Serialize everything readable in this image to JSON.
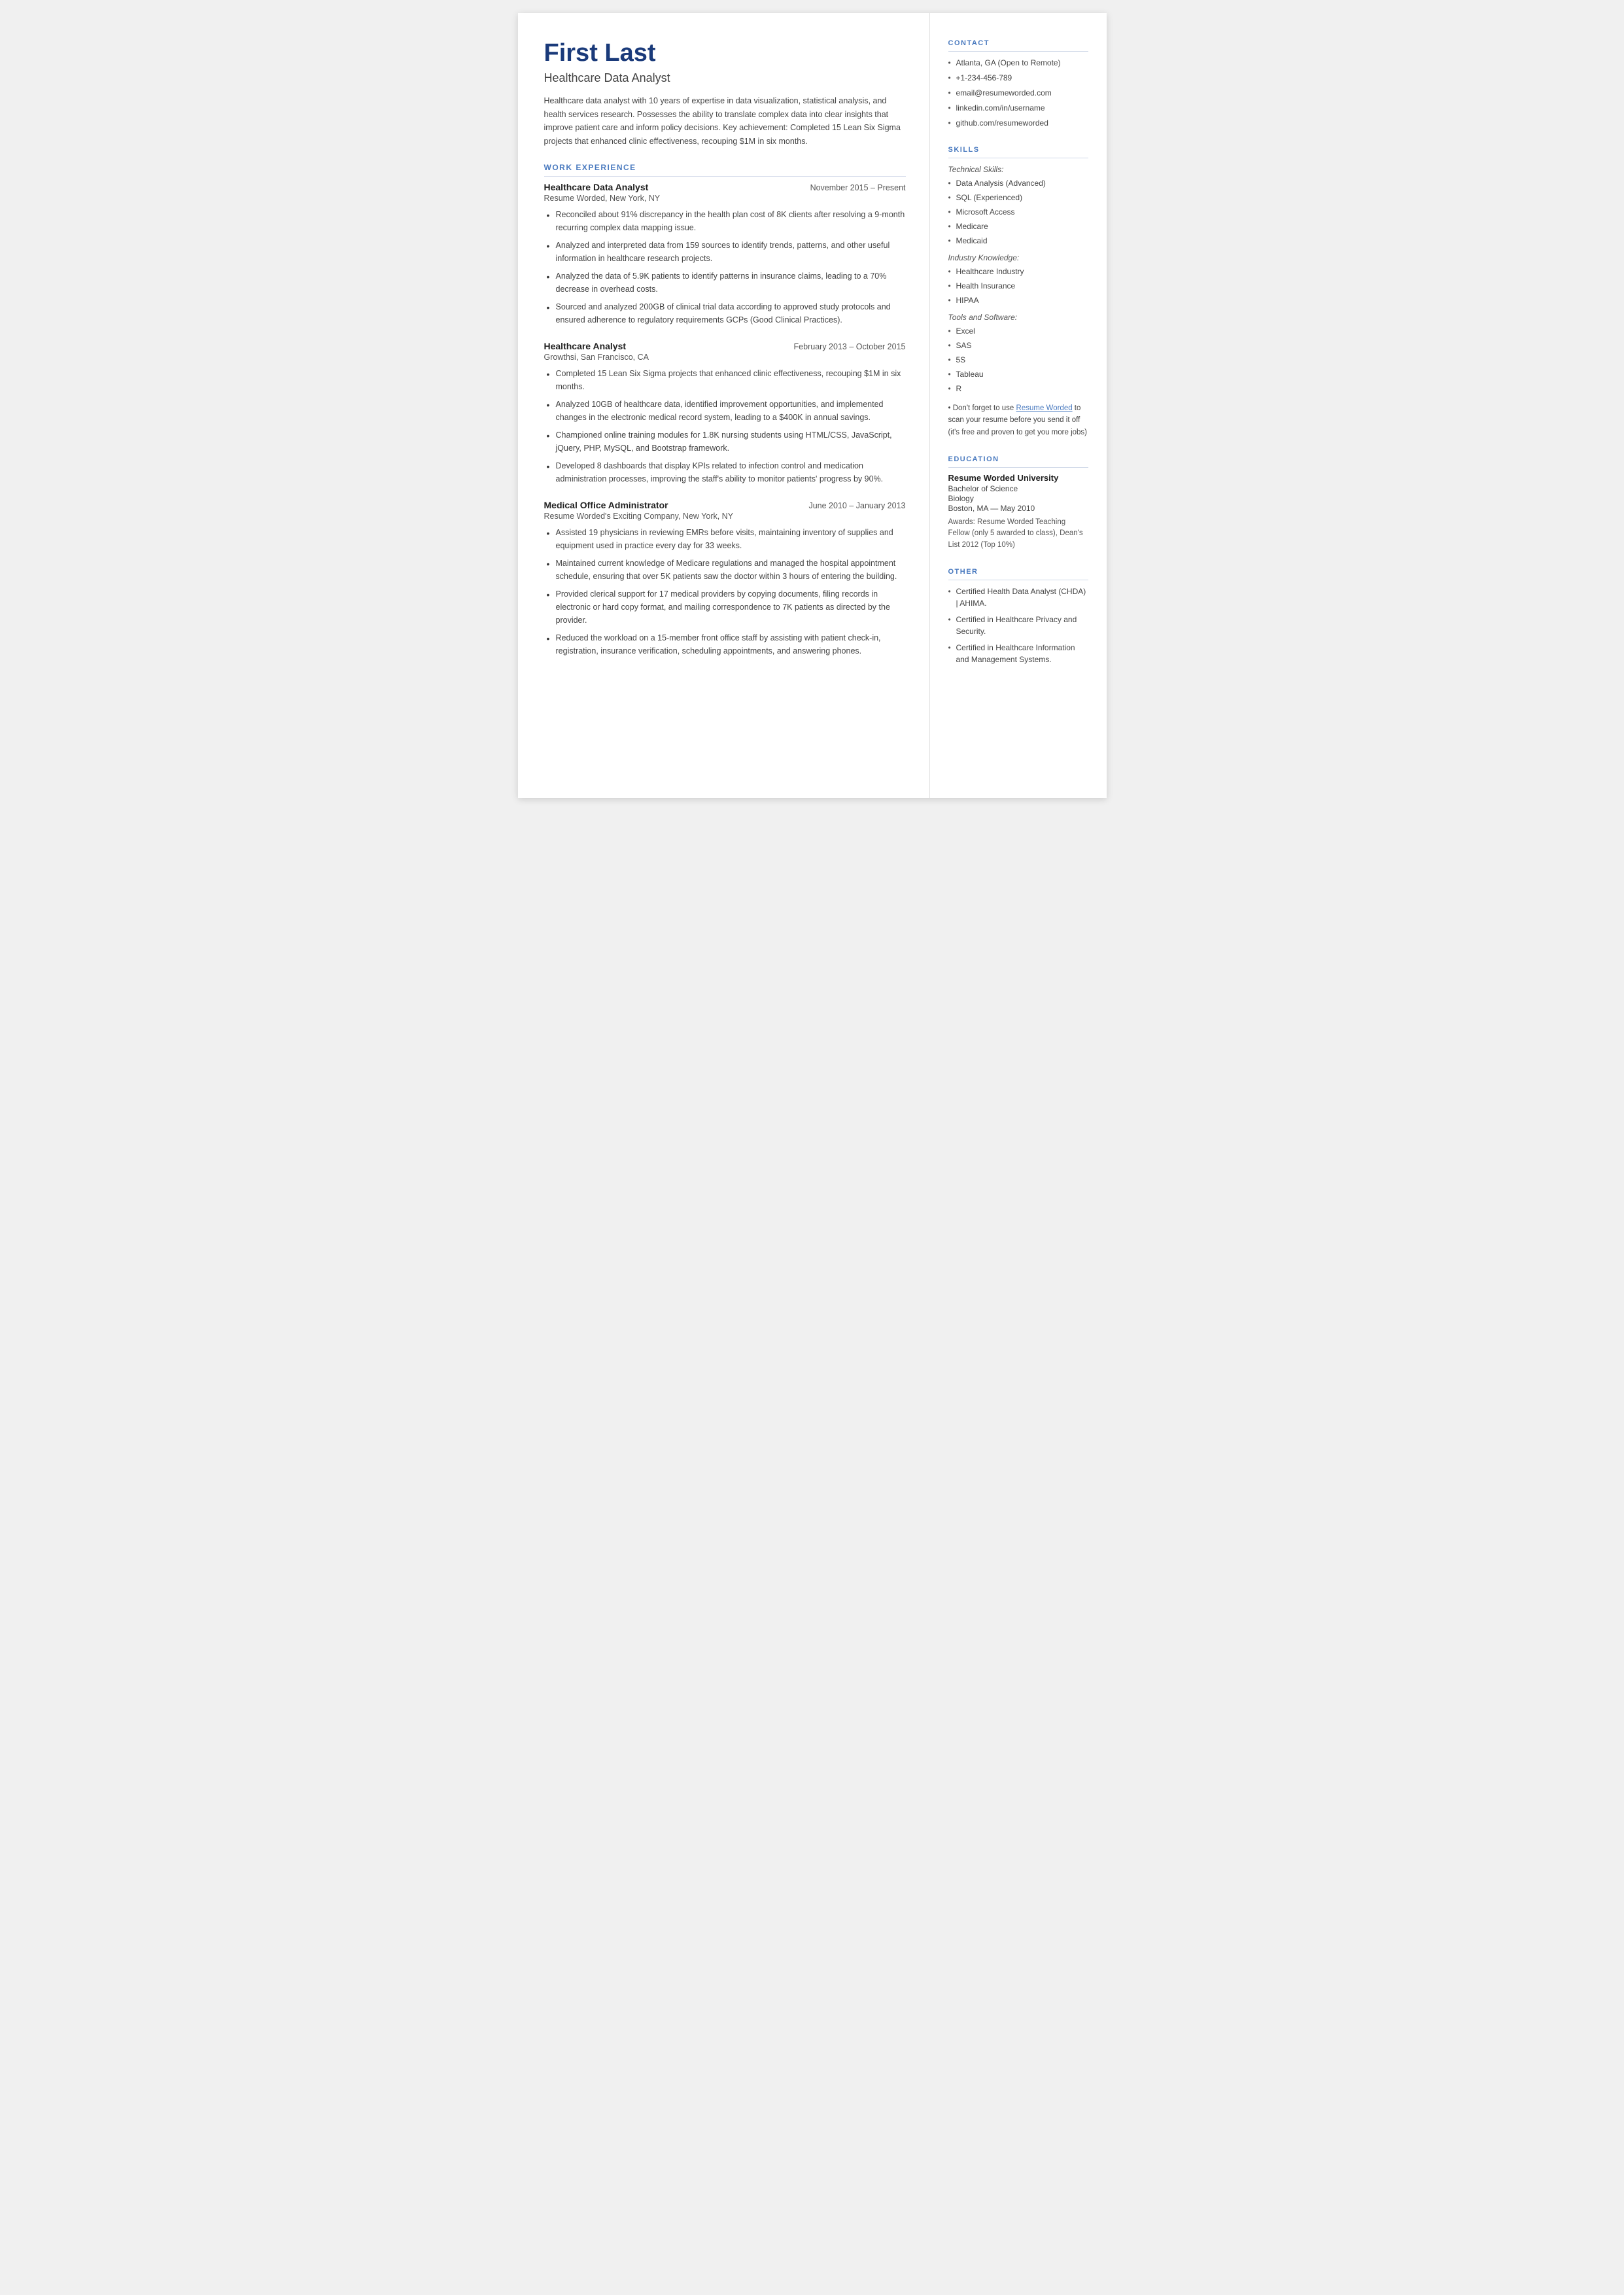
{
  "header": {
    "name": "First Last",
    "title": "Healthcare Data Analyst",
    "summary": "Healthcare data analyst with 10 years of expertise in data visualization, statistical analysis, and health services research. Possesses the ability to translate complex data into clear insights that improve patient care and inform policy decisions. Key achievement: Completed 15 Lean Six Sigma projects that enhanced clinic effectiveness, recouping $1M in six months."
  },
  "sections": {
    "work_experience_label": "WORK EXPERIENCE",
    "jobs": [
      {
        "title": "Healthcare Data Analyst",
        "dates": "November 2015 – Present",
        "company": "Resume Worded, New York, NY",
        "bullets": [
          "Reconciled about 91% discrepancy in the health plan cost of 8K clients after resolving a 9-month recurring complex data mapping issue.",
          "Analyzed and interpreted data from 159 sources to identify trends, patterns, and other useful information in healthcare research projects.",
          "Analyzed the data of 5.9K patients to identify patterns in insurance claims, leading to a 70% decrease in overhead costs.",
          "Sourced and analyzed 200GB of clinical trial data according to approved study protocols and ensured adherence to regulatory requirements GCPs (Good Clinical Practices)."
        ]
      },
      {
        "title": "Healthcare Analyst",
        "dates": "February 2013 – October 2015",
        "company": "Growthsi, San Francisco, CA",
        "bullets": [
          "Completed 15 Lean Six Sigma projects that enhanced clinic effectiveness, recouping $1M in six months.",
          "Analyzed 10GB of healthcare data, identified improvement opportunities, and implemented changes in the electronic medical record system, leading to a $400K in annual savings.",
          "Championed online training modules for 1.8K nursing students using HTML/CSS, JavaScript, jQuery, PHP, MySQL, and Bootstrap framework.",
          "Developed 8 dashboards that display KPIs related to infection control and medication administration processes, improving the staff's ability to monitor patients' progress by 90%."
        ]
      },
      {
        "title": "Medical Office Administrator",
        "dates": "June 2010 – January 2013",
        "company": "Resume Worded's Exciting Company, New York, NY",
        "bullets": [
          "Assisted 19 physicians in reviewing EMRs before visits, maintaining inventory of supplies and equipment used in practice every day for 33 weeks.",
          "Maintained current knowledge of Medicare regulations and managed the hospital appointment schedule, ensuring that over 5K patients saw the doctor within 3 hours of entering the building.",
          "Provided clerical support for 17 medical providers by copying documents, filing records in electronic or hard copy format, and mailing correspondence to 7K patients as directed by the provider.",
          "Reduced the workload on a 15-member front office staff by assisting with patient check-in, registration, insurance verification, scheduling appointments, and answering phones."
        ]
      }
    ]
  },
  "sidebar": {
    "contact_label": "CONTACT",
    "contact_items": [
      "Atlanta, GA (Open to Remote)",
      "+1-234-456-789",
      "email@resumeworded.com",
      "linkedin.com/in/username",
      "github.com/resumeworded"
    ],
    "skills_label": "SKILLS",
    "technical_skills_label": "Technical Skills:",
    "technical_skills": [
      "Data Analysis (Advanced)",
      "SQL (Experienced)",
      "Microsoft Access",
      "Medicare",
      "Medicaid"
    ],
    "industry_knowledge_label": "Industry Knowledge:",
    "industry_knowledge": [
      "Healthcare Industry",
      "Health Insurance",
      "HIPAA"
    ],
    "tools_label": "Tools and Software:",
    "tools": [
      "Excel",
      "SAS",
      "5S",
      "Tableau",
      "R"
    ],
    "promo": "Don't forget to use Resume Worded to scan your resume before you send it off (it's free and proven to get you more jobs)",
    "education_label": "EDUCATION",
    "education": {
      "school": "Resume Worded University",
      "degree": "Bachelor of Science",
      "field": "Biology",
      "location": "Boston, MA — May 2010",
      "awards": "Awards: Resume Worded Teaching Fellow (only 5 awarded to class), Dean's List 2012 (Top 10%)"
    },
    "other_label": "OTHER",
    "other_items": [
      "Certified Health Data Analyst (CHDA) | AHIMA.",
      "Certified in Healthcare Privacy and Security.",
      "Certified in Healthcare Information and Management Systems."
    ]
  }
}
